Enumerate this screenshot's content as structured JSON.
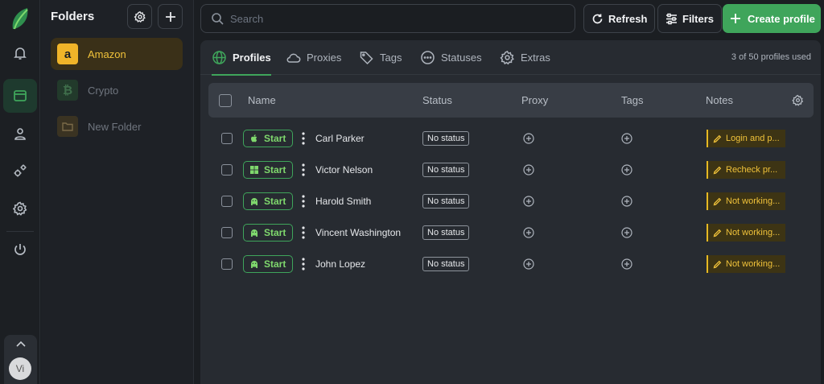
{
  "rail": {
    "items": [
      {
        "icon": "bell-icon"
      },
      {
        "icon": "browser-window-icon",
        "active": true
      },
      {
        "icon": "user-icon"
      },
      {
        "icon": "gears-icon"
      },
      {
        "icon": "settings-icon"
      },
      {
        "icon": "power-icon"
      }
    ],
    "user_initials": "Vi"
  },
  "folders": {
    "title": "Folders",
    "items": [
      {
        "label": "Amazon",
        "icon": "amazon-icon",
        "active": true
      },
      {
        "label": "Crypto",
        "icon": "bitcoin-icon"
      },
      {
        "label": "New Folder",
        "icon": "folder-icon"
      }
    ]
  },
  "topbar": {
    "search_placeholder": "Search",
    "refresh_label": "Refresh",
    "filters_label": "Filters",
    "create_label": "Create profile"
  },
  "tabs": [
    {
      "label": "Profiles",
      "icon": "globe-icon",
      "active": true
    },
    {
      "label": "Proxies",
      "icon": "cloud-icon"
    },
    {
      "label": "Tags",
      "icon": "tag-icon"
    },
    {
      "label": "Statuses",
      "icon": "dots-circle-icon"
    },
    {
      "label": "Extras",
      "icon": "gear-icon"
    }
  ],
  "usage": "3 of 50 profiles used",
  "table": {
    "columns": {
      "name": "Name",
      "status": "Status",
      "proxy": "Proxy",
      "tags": "Tags",
      "notes": "Notes"
    },
    "start_label": "Start",
    "rows": [
      {
        "name": "Carl Parker",
        "os": "apple-icon",
        "status": "No status",
        "note": "Login and p..."
      },
      {
        "name": "Victor Nelson",
        "os": "windows-icon",
        "status": "No status",
        "note": "Recheck pr..."
      },
      {
        "name": "Harold Smith",
        "os": "android-icon",
        "status": "No status",
        "note": "Not working..."
      },
      {
        "name": "Vincent Washington",
        "os": "android-icon",
        "status": "No status",
        "note": "Not working..."
      },
      {
        "name": "John Lopez",
        "os": "android-icon",
        "status": "No status",
        "note": "Not working..."
      }
    ]
  },
  "colors": {
    "accent": "#3fa55b",
    "note": "#f0c23a",
    "folder_active": "#3a3018"
  }
}
